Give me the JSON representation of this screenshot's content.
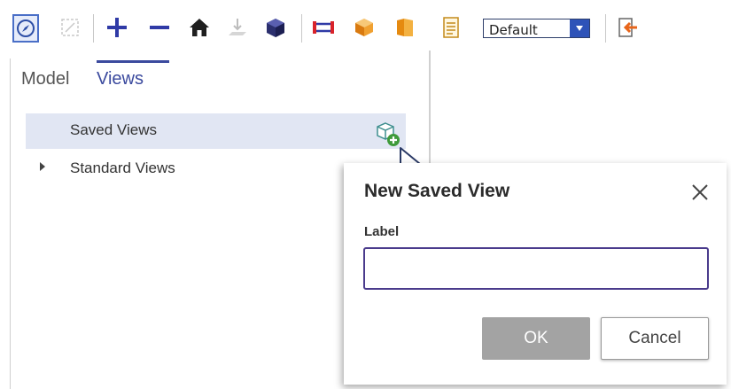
{
  "toolbar": {
    "icons": [
      "compass-icon",
      "fit-view-icon",
      "zoom-in-icon",
      "zoom-out-icon",
      "home-icon",
      "ground-icon",
      "cube-icon",
      "measure-icon",
      "section-box-icon",
      "book-icon",
      "list-icon",
      "exit-icon"
    ],
    "display_style": "Default"
  },
  "tabs": {
    "model": "Model",
    "views": "Views"
  },
  "tree": {
    "saved_views": "Saved Views",
    "standard_views": "Standard Views"
  },
  "dialog": {
    "title": "New Saved View",
    "label": "Label",
    "input_value": "",
    "ok": "OK",
    "cancel": "Cancel"
  },
  "colors": {
    "accent": "#3b4a9e",
    "selected_row": "#e1e6f3",
    "ok_disabled": "#a3a3a3"
  }
}
